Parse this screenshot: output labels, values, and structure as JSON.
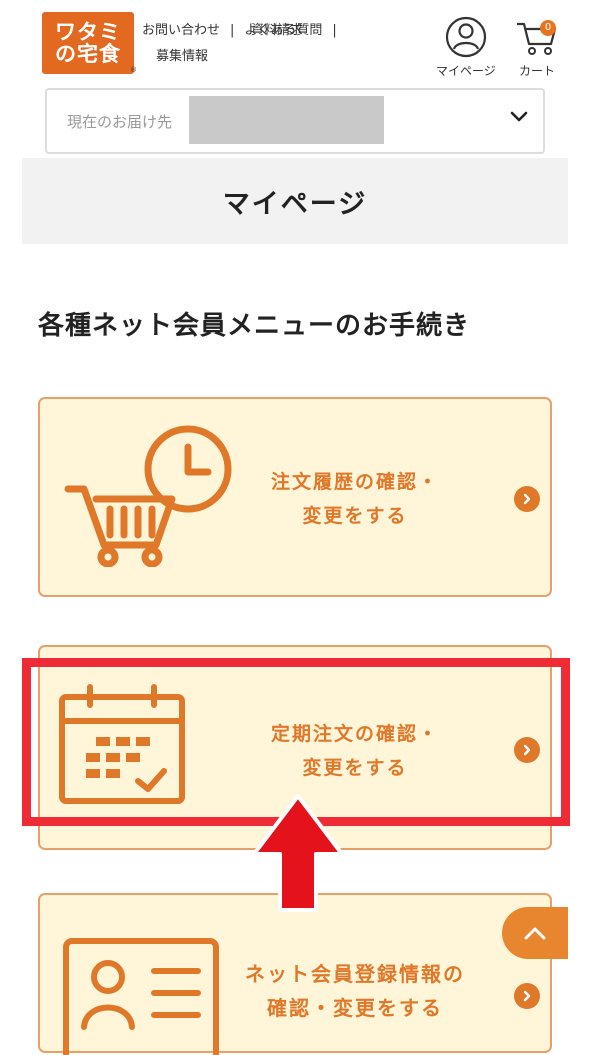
{
  "header": {
    "logo": {
      "line1": "ワタミ",
      "line2": "の宅食",
      "reg": "®"
    },
    "nav": {
      "contact": "お問い合わせ",
      "faq": "よくある質問",
      "documents": "資料請求",
      "recruit": "募集情報",
      "separator": "|"
    },
    "mypage_label": "マイページ",
    "cart_label": "カート",
    "cart_count": "0"
  },
  "delivery": {
    "label": "現在のお届け先"
  },
  "page_title": "マイページ",
  "section_heading": "各種ネット会員メニューのお手続き",
  "menu": [
    {
      "line1": "注文履歴の確認・",
      "line2": "変更をする",
      "icon": "cart-clock-icon"
    },
    {
      "line1": "定期注文の確認・",
      "line2": "変更をする",
      "icon": "calendar-icon"
    },
    {
      "line1": "ネット会員登録情報の",
      "line2": "確認・変更をする",
      "icon": "member-card-icon"
    }
  ],
  "colors": {
    "accent": "#e0782a",
    "card_bg": "#fff5d8",
    "highlight": "#ef2b35",
    "brand": "#e2691f"
  }
}
